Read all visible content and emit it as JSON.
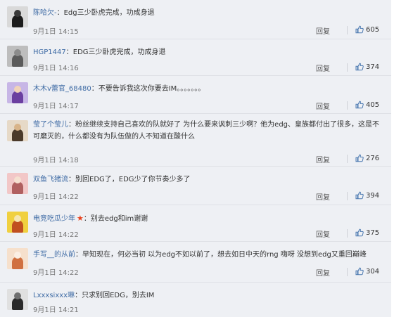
{
  "ui": {
    "reply_label": "回复",
    "name_separator": "："
  },
  "comments": [
    {
      "username": "陈哈欠-",
      "text": "Edg三少卧虎完成，功成身退",
      "time": "9月1日 14:15",
      "likes": "605",
      "avatar_colors": [
        "#d9d9d9",
        "#1c1c1c",
        "#3a3a3a"
      ]
    },
    {
      "username": "HGP1447",
      "text": "EDG三少卧虎完成，功成身退",
      "time": "9月1日 14:16",
      "likes": "374",
      "avatar_colors": [
        "#bdbdbd",
        "#5b5b5b",
        "#8c8c8c"
      ]
    },
    {
      "username": "木木v蕾官_68480",
      "text": "不要告诉我这次你要去IM。。。。。。。",
      "time": "9月1日 14:17",
      "likes": "405",
      "avatar_colors": [
        "#c7b6e6",
        "#6b3fa0",
        "#f1d3b8"
      ]
    },
    {
      "username": "莹了个莹儿",
      "text": "粉丝继续支持自己喜欢的队就好了 为什么要来讽刺三少啊？他为edg、皇族都付出了很多，这是不可磨灭的，什么都没有为队伍做的人不知道在酸什么",
      "time": "9月1日 14:18",
      "likes": "276",
      "avatar_colors": [
        "#e6d9c7",
        "#4a3a2a",
        "#d8b48a"
      ]
    },
    {
      "username": "双鱼飞猪流",
      "text": "别回EDG了，EDG少了你节奏少多了",
      "time": "9月1日 14:22",
      "likes": "394",
      "avatar_colors": [
        "#f2c7c7",
        "#b06060",
        "#f5e0d0"
      ]
    },
    {
      "username": "电竞吃瓜少年",
      "badge": "★",
      "text": "别去edg和im谢谢",
      "time": "9月1日 14:22",
      "likes": "375",
      "avatar_colors": [
        "#f0d040",
        "#c05020",
        "#f6e6b0"
      ]
    },
    {
      "username": "手写__的从前",
      "text": "早知现在，何必当初 以为edg不如以前了，想去如日中天的rng 嗨呀 没想到edg又重回巅峰",
      "time": "9月1日 14:22",
      "likes": "304",
      "avatar_colors": [
        "#f6e0cc",
        "#d07040",
        "#fbefe4"
      ]
    },
    {
      "username": "Lxxxsixxx琳",
      "text": "只求别回EDG，别去IM",
      "time": "9月1日 14:21",
      "likes": "",
      "avatar_colors": [
        "#e0e0e0",
        "#2a2a2a",
        "#707070"
      ]
    }
  ]
}
